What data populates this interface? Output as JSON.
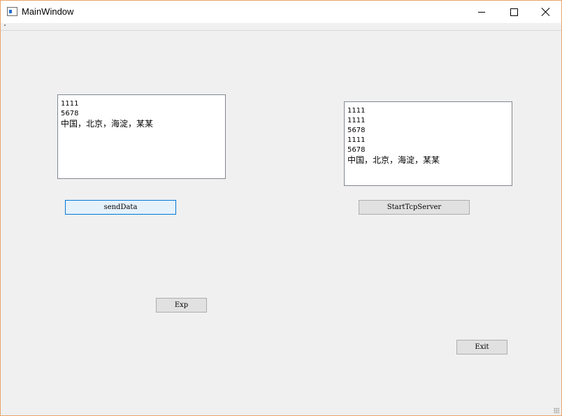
{
  "window": {
    "title": "MainWindow"
  },
  "left_text": {
    "lines": [
      "1111",
      "5678",
      "中国，北京，海淀，某某"
    ]
  },
  "right_text": {
    "lines": [
      "1111",
      "1111",
      "5678",
      "1111",
      "5678",
      "中国，北京，海淀，某某"
    ]
  },
  "buttons": {
    "send_data": "sendData",
    "start_server": "StartTcpServer",
    "exp": "Exp",
    "exit": "Exit"
  }
}
